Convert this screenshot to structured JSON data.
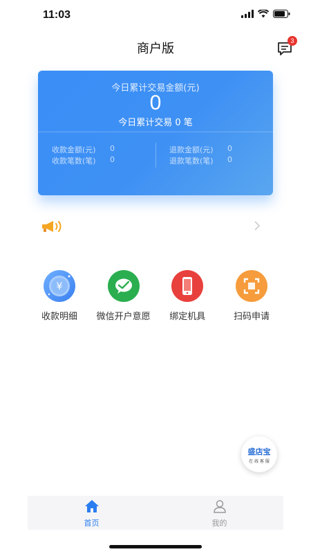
{
  "status_bar": {
    "time": "11:03"
  },
  "header": {
    "title": "商户版",
    "message_badge": "3"
  },
  "summary": {
    "label": "今日累计交易金额(元)",
    "amount": "0",
    "count_text": "今日累计交易 0 笔",
    "stats": {
      "receive_amount_label": "收款金额(元)",
      "receive_amount_value": "0",
      "receive_count_label": "收款笔数(笔)",
      "receive_count_value": "0",
      "refund_amount_label": "退款金额(元)",
      "refund_amount_value": "0",
      "refund_count_label": "退款笔数(笔)",
      "refund_count_value": "0"
    }
  },
  "notice": {
    "text": "",
    "icon": "speaker-icon"
  },
  "grid": [
    {
      "label": "收款明细",
      "icon": "yuan-coin-icon",
      "color": "#3b86f3"
    },
    {
      "label": "微信开户意愿",
      "icon": "wechat-icon",
      "color": "#2aae4f"
    },
    {
      "label": "绑定机具",
      "icon": "phone-device-icon",
      "color": "#e8403c"
    },
    {
      "label": "扫码申请",
      "icon": "scan-icon",
      "color": "#f69c3c"
    }
  ],
  "customer_service": {
    "logo": "盛店宝",
    "sub": "在 线 客 服"
  },
  "tabbar": [
    {
      "label": "首页",
      "icon": "home-icon",
      "active": true
    },
    {
      "label": "我的",
      "icon": "user-icon",
      "active": false
    }
  ],
  "colors": {
    "primary": "#3a8ef6",
    "active_tab": "#2b7ef0",
    "badge": "#e8342e"
  }
}
